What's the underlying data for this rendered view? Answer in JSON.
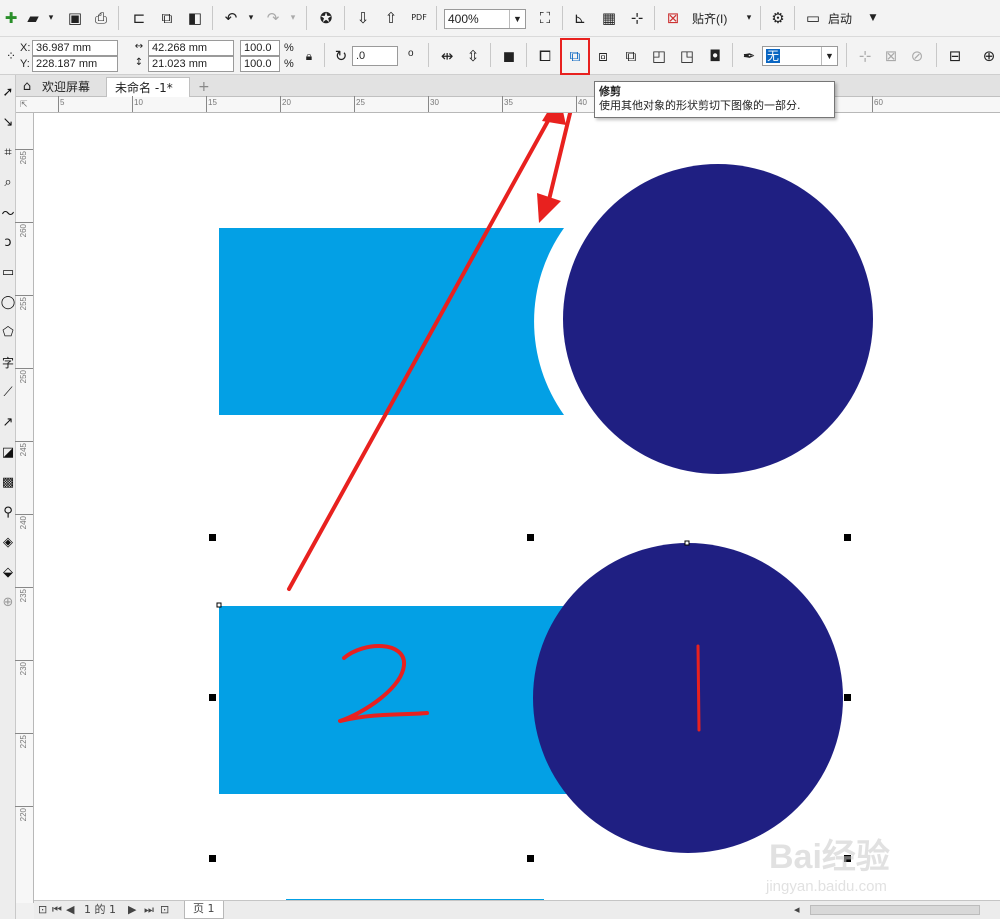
{
  "standard_toolbar": {
    "zoom_level": "400%",
    "snap_label": "贴齐(I)",
    "launch_label": "启动",
    "pdf_label": "PDF"
  },
  "property_bar": {
    "x_label": "X:",
    "y_label": "Y:",
    "x_value": "36.987 mm",
    "y_value": "228.187 mm",
    "width_value": "42.268 mm",
    "height_value": "21.023 mm",
    "scale_w": "100.0",
    "scale_h": "100.0",
    "percent": "%",
    "rotation_value": ".0",
    "degree": "o",
    "outline_value": "无"
  },
  "tabs": {
    "welcome": "欢迎屏幕",
    "document": "未命名 -1*",
    "add": "+"
  },
  "ruler": {
    "h_ticks": [
      "5",
      "10",
      "15",
      "20",
      "25",
      "30",
      "35",
      "40",
      "45",
      "50",
      "55",
      "60"
    ],
    "v_ticks": [
      "265",
      "260",
      "255",
      "250",
      "245",
      "240",
      "235",
      "230",
      "225",
      "220"
    ]
  },
  "tooltip": {
    "title": "修剪",
    "description": "使用其他对象的形状剪切下图像的一部分."
  },
  "annotations": {
    "label_1": "1",
    "label_2": "2"
  },
  "page_nav": {
    "page_info": "1 的 1",
    "page_tab": "页 1"
  },
  "watermark": {
    "brand": "Bai经验",
    "url": "jingyan.baidu.com"
  },
  "colors": {
    "rectangle": "#03a0e5",
    "circle": "#1f1f82",
    "highlight": "#e8211f",
    "annotation": "#e8211f"
  }
}
